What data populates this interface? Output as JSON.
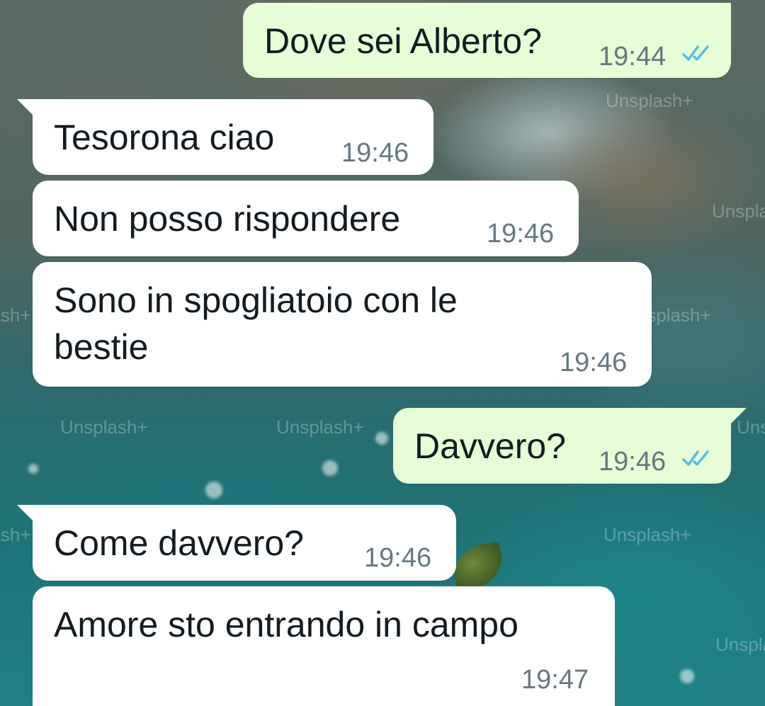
{
  "messages": [
    {
      "direction": "outgoing",
      "text": "Dove sei Alberto?",
      "time": "19:44",
      "status": "read"
    },
    {
      "direction": "incoming",
      "text": "Tesorona ciao",
      "time": "19:46"
    },
    {
      "direction": "incoming",
      "text": "Non posso rispondere",
      "time": "19:46"
    },
    {
      "direction": "incoming",
      "text_lines": [
        "Sono in spogliatoio con le",
        "bestie"
      ],
      "time": "19:46"
    },
    {
      "direction": "outgoing",
      "text": "Davvero?",
      "time": "19:46",
      "status": "read"
    },
    {
      "direction": "incoming",
      "text": "Come davvero?",
      "time": "19:46"
    },
    {
      "direction": "incoming",
      "text": "Amore sto entrando in campo",
      "time": "19:47"
    }
  ],
  "wallpaper": {
    "watermark": "Unsplash+"
  },
  "colors": {
    "incoming_bubble": "#ffffff",
    "outgoing_bubble": "#e7fdd6",
    "read_ticks": "#53bdeb",
    "time_text": "#667781",
    "message_text": "#111b21"
  },
  "icons": {
    "read_status": "double-check-icon"
  }
}
